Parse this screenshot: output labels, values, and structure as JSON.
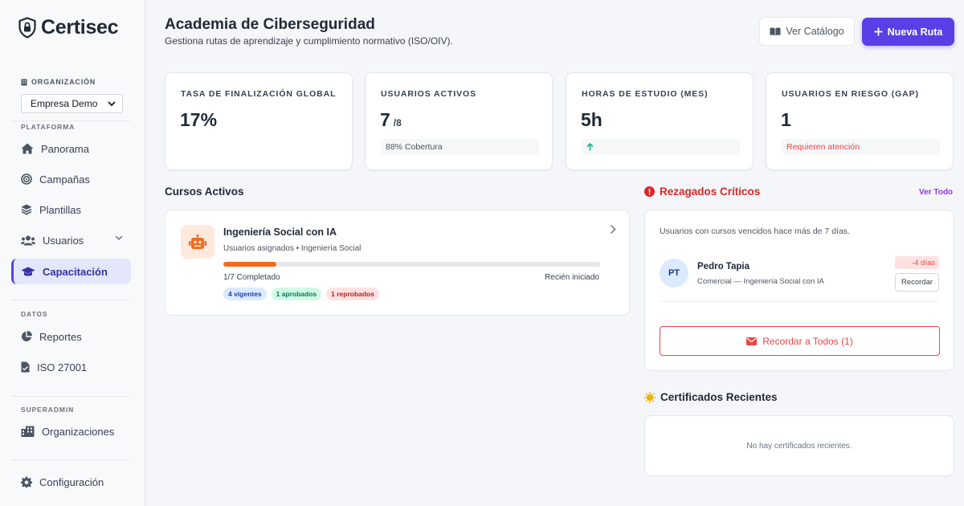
{
  "brand": {
    "name": "Certisec"
  },
  "sidebar": {
    "org_label": "ORGANIZACIÓN",
    "org_selected": "Empresa Demo",
    "section_platform": "PLATAFORMA",
    "section_data": "DATOS",
    "section_superadmin": "SUPERADMIN",
    "items": [
      {
        "label": "Panorama",
        "icon": "home-icon"
      },
      {
        "label": "Campañas",
        "icon": "target-icon"
      },
      {
        "label": "Plantillas",
        "icon": "layers-icon"
      },
      {
        "label": "Usuarios",
        "icon": "users-icon"
      },
      {
        "label": "Capacitación",
        "icon": "graduation-cap-icon",
        "active": true
      },
      {
        "label": "Reportes",
        "icon": "pie-chart-icon"
      },
      {
        "label": "ISO 27001",
        "icon": "document-icon"
      },
      {
        "label": "Organizaciones",
        "icon": "building-icon"
      },
      {
        "label": "Configuración",
        "icon": "gear-icon"
      }
    ]
  },
  "header": {
    "title": "Academia de Ciberseguridad",
    "subtitle": "Gestiona rutas de aprendizaje y cumplimiento normativo (ISO/OIV).",
    "catalog_button": "Ver Catálogo",
    "new_button": "Nueva Ruta"
  },
  "stats": [
    {
      "label": "TASA DE FINALIZACIÓN GLOBAL",
      "value": "17%",
      "unit": "",
      "foot": ""
    },
    {
      "label": "USUARIOS ACTIVOS",
      "value": "7",
      "unit": "/8",
      "foot": "88% Cobertura"
    },
    {
      "label": "HORAS DE ESTUDIO (MES)",
      "value": "5h",
      "unit": "",
      "foot": ""
    },
    {
      "label": "USUARIOS EN RIESGO (GAP)",
      "value": "1",
      "unit": "",
      "foot": "Requieren atención"
    }
  ],
  "courses": {
    "title": "Cursos Activos",
    "items": [
      {
        "name": "Ingeniería Social con IA",
        "meta": "Usuarios asignados • Ingeniería Social",
        "progress": 0.14,
        "completed": "1/7 Completado",
        "status": "Recién iniciado",
        "badges": [
          "4 vigentes",
          "1 aprobados",
          "1 reprobados"
        ]
      }
    ]
  },
  "laggards": {
    "title": "Rezagados Críticos",
    "view_all": "Ver Todo",
    "description": "Usuarios con cursos vencidos hace más de 7 días.",
    "user": {
      "initials": "PT",
      "name": "Pedro Tapia",
      "course": "Comercial — Ingeniería Social con IA",
      "days": "-4 días",
      "remind": "Recordar"
    },
    "remind_all": "Recordar a Todos (1)"
  },
  "certificates": {
    "title": "Certificados Recientes",
    "empty": "No hay certificados recientes."
  },
  "colors": {
    "accent": "#5b3fe6",
    "danger": "#ef4444",
    "progress": "#f26b1d"
  }
}
